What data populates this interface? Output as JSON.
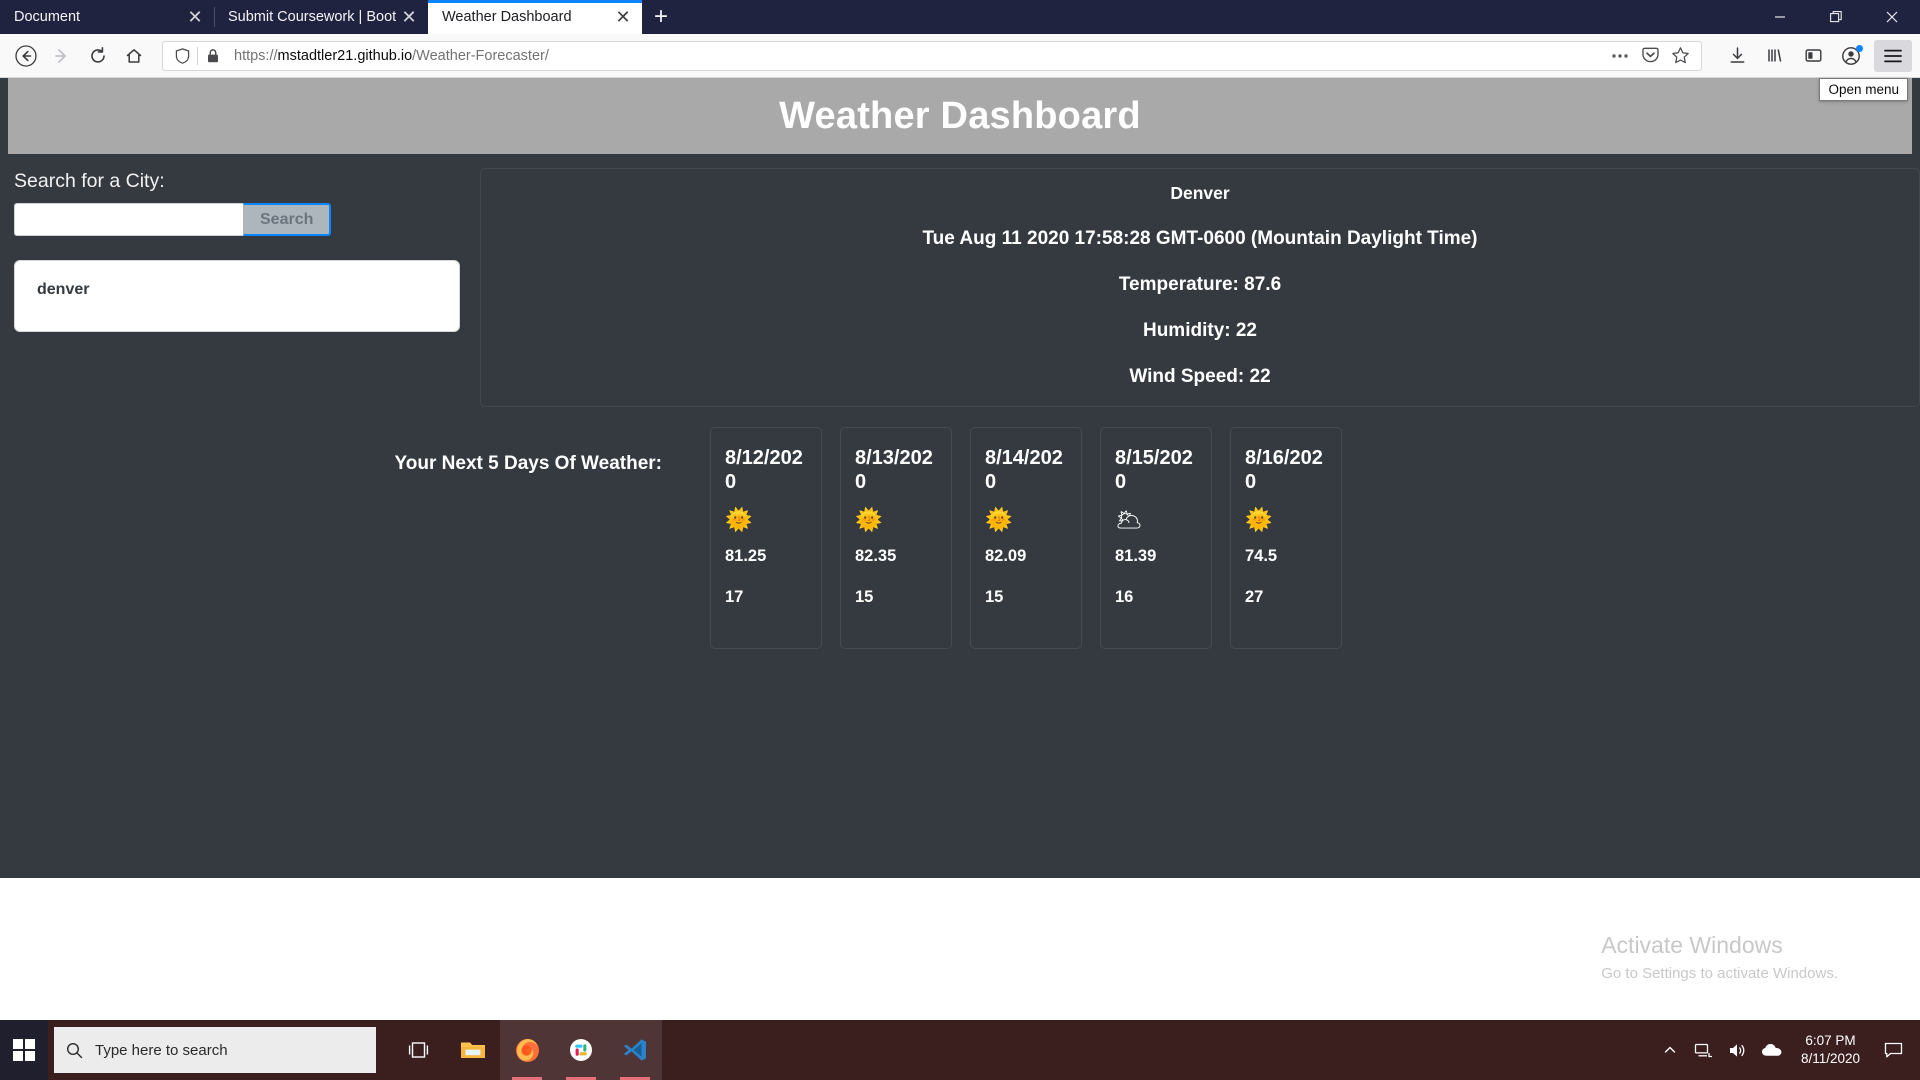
{
  "browser": {
    "tabs": [
      {
        "title": "Document",
        "dim_suffix": "",
        "active": false
      },
      {
        "title": "Submit Coursework | Bootcamp ",
        "dim_suffix": "Sp",
        "active": false
      },
      {
        "title": "Weather Dashboard",
        "dim_suffix": "",
        "active": true
      }
    ],
    "new_tab_label": "+",
    "tab_close_label": "✕",
    "window_controls": {
      "minimize": "—",
      "restore": "❐",
      "close": "✕"
    },
    "nav": {
      "back": "←",
      "forward": "→",
      "reload": "⟳",
      "home": "⌂"
    },
    "url": {
      "scheme": "https://",
      "host": "mstadtler21.github.io",
      "path": "/Weather-Forecaster/"
    },
    "tooltip": "Open menu",
    "icons": {
      "shield": "shield-icon",
      "lock": "lock-icon",
      "page-actions": "ellipsis-icon",
      "pocket": "pocket-icon",
      "bookmark": "star-icon",
      "downloads": "download-icon",
      "library": "library-icon",
      "sidebar": "sidebar-icon",
      "account": "account-icon",
      "menu": "hamburger-menu-icon"
    },
    "accent_color": "#0a84ff"
  },
  "page": {
    "title": "Weather Dashboard",
    "banner_color": "#a9a9a9",
    "background_color": "#343a40",
    "search": {
      "label": "Search for a City:",
      "input_value": "",
      "input_placeholder": "",
      "button_label": "Search",
      "history": [
        "denver"
      ]
    },
    "current": {
      "city": "Denver",
      "datetime": "Tue Aug 11 2020 17:58:28 GMT-0600 (Mountain Daylight Time)",
      "temperature": "Temperature: 87.6",
      "humidity": "Humidity: 22",
      "wind_speed": "Wind Speed: 22"
    },
    "forecast": {
      "title": "Your Next 5 Days Of Weather:",
      "days": [
        {
          "date": "8/12/2020",
          "icon": "🌞",
          "icon_name": "sun-icon",
          "temp": "81.25",
          "humidity": "17"
        },
        {
          "date": "8/13/2020",
          "icon": "🌞",
          "icon_name": "sun-icon",
          "temp": "82.35",
          "humidity": "15"
        },
        {
          "date": "8/14/2020",
          "icon": "🌞",
          "icon_name": "sun-icon",
          "temp": "82.09",
          "humidity": "15"
        },
        {
          "date": "8/15/2020",
          "icon": "🌥",
          "icon_name": "cloud-icon",
          "temp": "81.39",
          "humidity": "16"
        },
        {
          "date": "8/16/2020",
          "icon": "🌞",
          "icon_name": "sun-icon",
          "temp": "74.5",
          "humidity": "27"
        }
      ]
    }
  },
  "watermark": {
    "line1": "Activate Windows",
    "line2": "Go to Settings to activate Windows."
  },
  "taskbar": {
    "search_placeholder": "Type here to search",
    "apps": [
      "task-view",
      "file-explorer",
      "firefox",
      "slack",
      "vscode"
    ],
    "tray": [
      "show-hidden-icons",
      "network",
      "volume",
      "onedrive"
    ],
    "time": "6:07 PM",
    "date": "8/11/2020"
  }
}
